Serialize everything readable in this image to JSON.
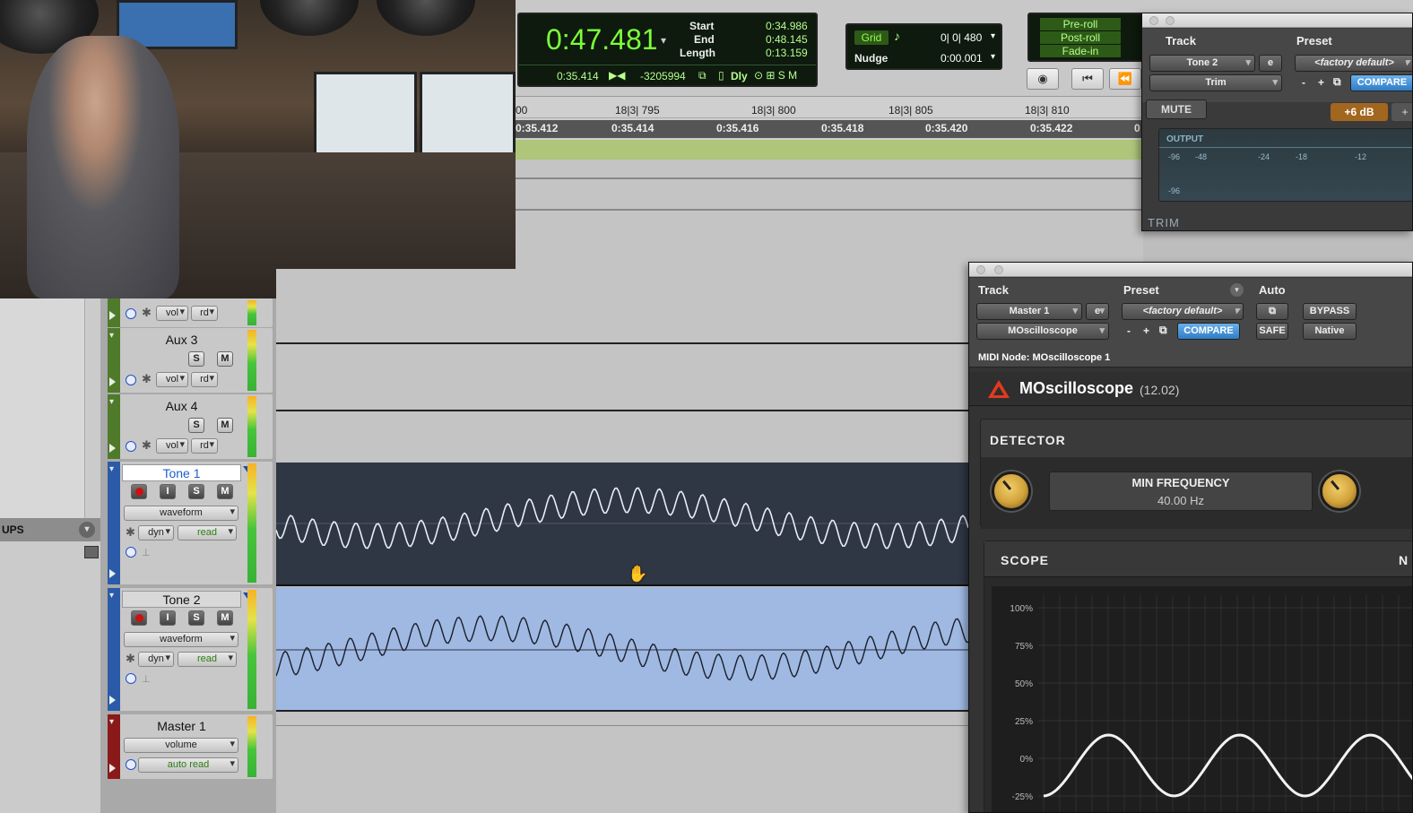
{
  "transport": {
    "main_counter": "0:47.481",
    "start_label": "Start",
    "end_label": "End",
    "length_label": "Length",
    "start_value": "0:34.986",
    "end_value": "0:48.145",
    "length_value": "0:13.159",
    "sub_counter": "0:35.414",
    "sample_offset": "-3205994",
    "dly_label": "Dly",
    "grid_label": "Grid",
    "grid_value": "0| 0| 480",
    "nudge_label": "Nudge",
    "nudge_value": "0:00.001",
    "preroll_label": "Pre-roll",
    "postroll_label": "Post-roll",
    "fadein_label": "Fade-in"
  },
  "ruler": {
    "bars": [
      {
        "label": "00"
      },
      {
        "label": "18|3| 795"
      },
      {
        "label": "18|3| 800"
      },
      {
        "label": "18|3| 805"
      },
      {
        "label": "18|3| 810"
      }
    ],
    "times": [
      {
        "label": "0:35.412"
      },
      {
        "label": "0:35.414"
      },
      {
        "label": "0:35.416"
      },
      {
        "label": "0:35.418"
      },
      {
        "label": "0:35.420"
      },
      {
        "label": "0:35.422"
      },
      {
        "label": "0"
      }
    ]
  },
  "sidebar": {
    "groups_label": "UPS"
  },
  "tracks": [
    {
      "name": "",
      "view": "vol",
      "auto": "rd",
      "color": "#4f7a2a"
    },
    {
      "name": "Aux 3",
      "view": "vol",
      "auto": "rd",
      "color": "#4f7a2a"
    },
    {
      "name": "Aux 4",
      "view": "vol",
      "auto": "rd",
      "color": "#4f7a2a"
    },
    {
      "name": "Tone 1",
      "view": "waveform",
      "dyn": "dyn",
      "auto": "read",
      "color": "#2a5aa8"
    },
    {
      "name": "Tone 2",
      "view": "waveform",
      "dyn": "dyn",
      "auto": "read",
      "color": "#2a5aa8"
    },
    {
      "name": "Master 1",
      "view": "volume",
      "auto": "auto read",
      "color": "#8a1a1a"
    }
  ],
  "button_labels": {
    "solo": "S",
    "mute": "M",
    "input": "I"
  },
  "trim_plugin": {
    "track_label": "Track",
    "preset_label": "Preset",
    "track_name": "Tone 2",
    "insert_name": "Trim",
    "e_label": "e",
    "preset_value": "<factory default>",
    "minus": "-",
    "plus": "+",
    "compare": "COMPARE",
    "mute": "MUTE",
    "gain": "+6 dB",
    "output_label": "OUTPUT",
    "scale": [
      "-96",
      "-48",
      "-24",
      "-18",
      "-12"
    ],
    "scale_floor": "-96",
    "footer": "TRIM"
  },
  "mosc_plugin": {
    "track_label": "Track",
    "preset_label": "Preset",
    "auto_label": "Auto",
    "track_name": "Master 1",
    "insert_name": "MOscilloscope",
    "e_label": "e",
    "preset_value": "<factory default>",
    "minus": "-",
    "plus": "+",
    "compare": "COMPARE",
    "bypass": "BYPASS",
    "safe": "SAFE",
    "native": "Native",
    "midi_node": "MIDI Node: MOscilloscope 1",
    "plugin_name": "MOscilloscope",
    "version": "(12.02)",
    "detector_label": "DETECTOR",
    "min_freq_label": "MIN FREQUENCY",
    "min_freq_value": "40.00 Hz",
    "scope_label": "SCOPE",
    "scope_right": "N",
    "scope_ticks": [
      "100%",
      "75%",
      "50%",
      "25%",
      "0%",
      "-25%"
    ]
  },
  "colors": {
    "lcd_green": "#7dff3b",
    "compare_blue": "#2f7cc6",
    "tone_region": "#9fb9e3",
    "tone1_region": "#2f3644"
  }
}
